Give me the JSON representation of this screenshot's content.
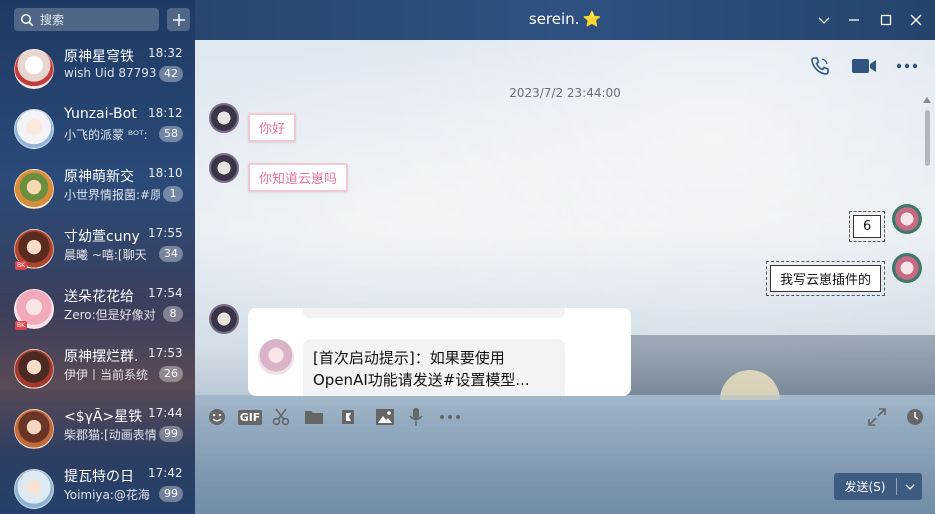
{
  "search": {
    "placeholder": "搜索"
  },
  "window": {
    "title": "serein.",
    "title_emoji": "⭐"
  },
  "conversations": [
    {
      "name": "原神星穹铁",
      "time": "18:32",
      "preview": "wish Uid 87793",
      "count": "42"
    },
    {
      "name": "Yunzai-Bot",
      "time": "18:12",
      "preview": "小飞的派蒙 ᴮᴼᵀ:",
      "count": "58"
    },
    {
      "name": "原神萌新交",
      "time": "18:10",
      "preview": "小世界情报菌:#原",
      "count": "1"
    },
    {
      "name": "寸幼萱cuny",
      "time": "17:55",
      "preview": "晨曦 ~嘻:[聊天",
      "count": "34",
      "mini": "BK"
    },
    {
      "name": "送朵花花给",
      "time": "17:54",
      "preview": "Zero:但是好像对",
      "count": "8",
      "mini": "BK"
    },
    {
      "name": "原神摆烂群.",
      "time": "17:53",
      "preview": "伊伊丨当前系统",
      "count": "26"
    },
    {
      "name": "<$γĀ>星铁",
      "time": "17:44",
      "preview": "柴郡猫:[动画表情",
      "count": "99"
    },
    {
      "name": "提瓦特の日",
      "time": "17:42",
      "preview": "Yoimiya:@花海",
      "count": "99"
    }
  ],
  "chat": {
    "timestamp": "2023/7/2 23:44:00",
    "messages": [
      {
        "text": "你好"
      },
      {
        "text": "你知道云崽吗"
      },
      {
        "text": "6"
      },
      {
        "text": "我写云崽插件的"
      }
    ],
    "card_text": "[首次启动提示]：如果要使用OpenAI功能请发送#设置模型..."
  },
  "toolbar": {
    "gif_label": "GIF"
  },
  "send": {
    "label": "发送(S)"
  },
  "colors": {
    "accent": "#3d5a80",
    "bubble_border": "#f2c7d6",
    "bubble_text": "#e9739b"
  }
}
